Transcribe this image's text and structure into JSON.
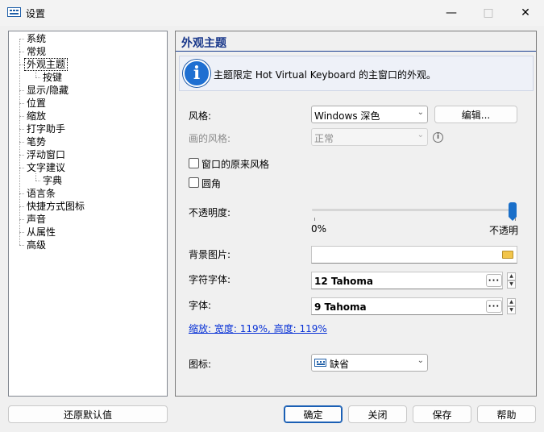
{
  "window": {
    "title": "设置",
    "minimize_icon": "minimize-icon",
    "maximize_icon": "maximize-icon",
    "close_icon": "close-icon"
  },
  "tree": {
    "items": [
      {
        "label": "系统"
      },
      {
        "label": "常规"
      },
      {
        "label": "外观主题",
        "selected": true
      },
      {
        "label": "按键"
      },
      {
        "label": "显示/隐藏"
      },
      {
        "label": "位置"
      },
      {
        "label": "缩放"
      },
      {
        "label": "打字助手"
      },
      {
        "label": "笔势"
      },
      {
        "label": "浮动窗口"
      },
      {
        "label": "文字建议"
      },
      {
        "label": "字典"
      },
      {
        "label": "语言条"
      },
      {
        "label": "快捷方式图标"
      },
      {
        "label": "声音"
      },
      {
        "label": "从属性"
      },
      {
        "label": "高级"
      }
    ]
  },
  "panel": {
    "title": "外观主题",
    "info_text": "主题限定 Hot Virtual Keyboard 的主窗口的外观。",
    "style_label": "风格:",
    "style_value": "Windows 深色",
    "edit_button": "编辑...",
    "paint_style_label": "画的风格:",
    "paint_style_value": "正常",
    "window_native_style_label": "窗口的原来风格",
    "window_native_style_checked": false,
    "rounded_label": "圆角",
    "rounded_checked": false,
    "opacity_label": "不透明度:",
    "opacity_min_label": "0%",
    "opacity_max_label": "不透明",
    "opacity_value": 1.0,
    "background_label": "背景图片:",
    "background_value": "",
    "char_font_label": "字符字体:",
    "char_font_value": "12 Tahoma",
    "font_label": "字体:",
    "font_value": "9 Tahoma",
    "scale_link": "缩放: 宽度: 119%, 高度: 119%",
    "icon_label": "图标:",
    "icon_value": "缺省",
    "ellipsis": "···"
  },
  "footer": {
    "restore_defaults": "还原默认值",
    "ok": "确定",
    "close": "关闭",
    "save": "保存",
    "help": "帮助"
  },
  "colors": {
    "accent": "#1a6fc9",
    "header_text": "#18378a",
    "link": "#0a33d6"
  }
}
